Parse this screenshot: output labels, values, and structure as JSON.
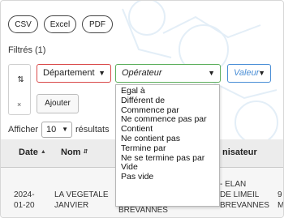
{
  "toolbar": {
    "csv_label": "CSV",
    "excel_label": "Excel",
    "pdf_label": "PDF"
  },
  "filters": {
    "title": "Filtrés (1)",
    "department_select": "Département",
    "operator_select": "Opérateur",
    "value_select": "Valeur",
    "add_button": "Ajouter",
    "icon_top": "⇄",
    "icon_remove": "×"
  },
  "operator_options": [
    "Egal à",
    "Différent de",
    "Commence par",
    "Ne commence pas par",
    "Contient",
    "Ne contient pas",
    "Termine par",
    "Ne se termine pas par",
    "Vide",
    "Pas vide"
  ],
  "entries": {
    "show_label": "Afficher",
    "value": "10",
    "results_label": "résultats"
  },
  "table": {
    "headers": {
      "date": "Date",
      "nom": "Nom",
      "organisateur": "nisateur"
    },
    "row": {
      "date_line1": "2024-",
      "date_line2": "01-20",
      "nom_line1": "LA VEGETALE",
      "nom_line2": "JANVIER",
      "lieu_cut": "BREVANNES",
      "org_line1": "- ELAN",
      "org_line2": "DE LIMEIL",
      "org_line3": "BREVANNES",
      "edge_line1": "9",
      "edge_line2": "M"
    }
  },
  "colors": {
    "department_border": "#d94b4b",
    "operator_border": "#5cae5c",
    "value_border": "#4b8fd6"
  }
}
